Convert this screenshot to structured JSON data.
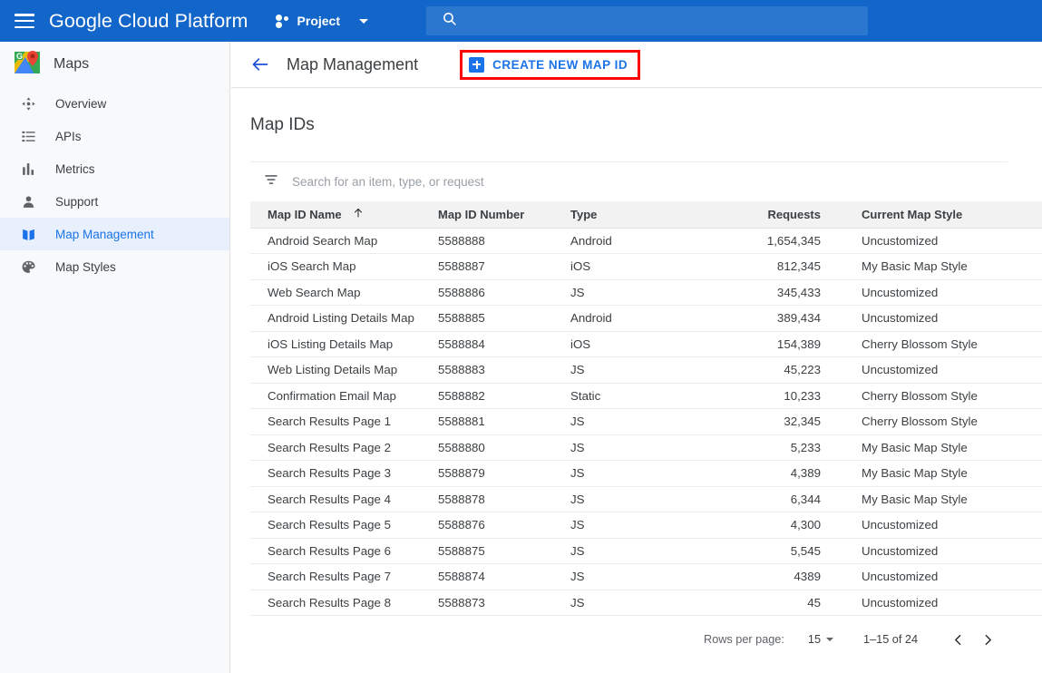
{
  "topbar": {
    "menu_icon": "hamburger-menu-icon",
    "brand_google": "Google",
    "brand_rest": "Cloud Platform",
    "project_label": "Project",
    "project_icon": "project-dots-icon",
    "caret_icon": "chevron-down-icon",
    "search_icon": "search-icon",
    "search_value": "",
    "search_placeholder": "",
    "bg_color": "#1266c9",
    "search_bg_color": "#2b77cf"
  },
  "sidebar": {
    "product_name": "Maps",
    "product_icon": "google-maps-logo-icon",
    "active_bg_color": "#e8f0fe",
    "active_text_color": "#1a73e8",
    "items": [
      {
        "label": "Overview",
        "icon": "overview-move-icon",
        "active": false
      },
      {
        "label": "APIs",
        "icon": "list-icon",
        "active": false
      },
      {
        "label": "Metrics",
        "icon": "bar-chart-icon",
        "active": false
      },
      {
        "label": "Support",
        "icon": "person-icon",
        "active": false
      },
      {
        "label": "Map Management",
        "icon": "map-icon",
        "active": true
      },
      {
        "label": "Map Styles",
        "icon": "palette-icon",
        "active": false
      }
    ]
  },
  "content": {
    "back_icon": "back-arrow-icon",
    "page_title": "Map Management",
    "create_button_label": "CREATE NEW MAP ID",
    "create_button_icon": "plus-icon",
    "create_button_highlight_color": "#ff0000",
    "section_title": "Map IDs",
    "filter": {
      "icon": "filter-icon",
      "value": "",
      "placeholder": "Search for an item, type, or request"
    },
    "table": {
      "columns": [
        {
          "label": "Map ID Name",
          "align": "left",
          "sort_icon": "sort-ascending-arrow-icon"
        },
        {
          "label": "Map ID Number",
          "align": "left",
          "sort_icon": ""
        },
        {
          "label": "Type",
          "align": "left",
          "sort_icon": ""
        },
        {
          "label": "Requests",
          "align": "right",
          "sort_icon": ""
        },
        {
          "label": "Current Map Style",
          "align": "left",
          "sort_icon": ""
        }
      ],
      "rows": [
        {
          "name": "Android Search Map",
          "number": "5588888",
          "type": "Android",
          "requests": "1,654,345",
          "style": "Uncustomized"
        },
        {
          "name": "iOS Search Map",
          "number": "5588887",
          "type": "iOS",
          "requests": "812,345",
          "style": "My Basic Map Style"
        },
        {
          "name": "Web Search Map",
          "number": "5588886",
          "type": "JS",
          "requests": "345,433",
          "style": "Uncustomized"
        },
        {
          "name": "Android Listing Details Map",
          "number": "5588885",
          "type": "Android",
          "requests": "389,434",
          "style": "Uncustomized"
        },
        {
          "name": "iOS Listing Details Map",
          "number": "5588884",
          "type": "iOS",
          "requests": "154,389",
          "style": "Cherry Blossom Style"
        },
        {
          "name": "Web Listing Details Map",
          "number": "5588883",
          "type": "JS",
          "requests": "45,223",
          "style": "Uncustomized"
        },
        {
          "name": "Confirmation Email Map",
          "number": "5588882",
          "type": "Static",
          "requests": "10,233",
          "style": "Cherry Blossom Style"
        },
        {
          "name": "Search Results Page 1",
          "number": "5588881",
          "type": "JS",
          "requests": "32,345",
          "style": "Cherry Blossom Style"
        },
        {
          "name": "Search Results Page 2",
          "number": "5588880",
          "type": "JS",
          "requests": "5,233",
          "style": "My Basic Map Style"
        },
        {
          "name": "Search Results Page 3",
          "number": "5588879",
          "type": "JS",
          "requests": "4,389",
          "style": "My Basic Map Style"
        },
        {
          "name": "Search Results Page 4",
          "number": "5588878",
          "type": "JS",
          "requests": "6,344",
          "style": "My Basic Map Style"
        },
        {
          "name": "Search Results Page 5",
          "number": "5588876",
          "type": "JS",
          "requests": "4,300",
          "style": "Uncustomized"
        },
        {
          "name": "Search Results Page 6",
          "number": "5588875",
          "type": "JS",
          "requests": "5,545",
          "style": "Uncustomized"
        },
        {
          "name": "Search Results Page 7",
          "number": "5588874",
          "type": "JS",
          "requests": "4389",
          "style": "Uncustomized"
        },
        {
          "name": "Search Results Page 8",
          "number": "5588873",
          "type": "JS",
          "requests": "45",
          "style": "Uncustomized"
        }
      ]
    },
    "pagination": {
      "rows_per_page_label": "Rows per page:",
      "rows_per_page_value": "15",
      "range_label": "1–15 of 24",
      "prev_icon": "chevron-left-icon",
      "next_icon": "chevron-right-icon"
    }
  }
}
